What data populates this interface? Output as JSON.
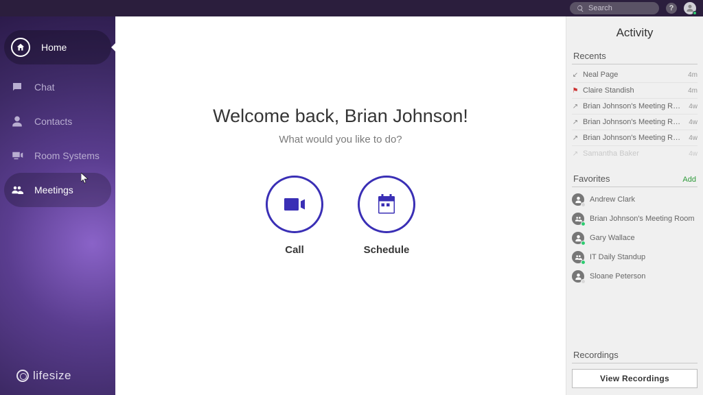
{
  "topbar": {
    "search_placeholder": "Search"
  },
  "sidebar": {
    "items": [
      {
        "label": "Home"
      },
      {
        "label": "Chat"
      },
      {
        "label": "Contacts"
      },
      {
        "label": "Room Systems"
      },
      {
        "label": "Meetings"
      }
    ],
    "logo": "lifesize"
  },
  "main": {
    "welcome": "Welcome back, Brian Johnson!",
    "subtitle": "What would you like to do?",
    "call_label": "Call",
    "schedule_label": "Schedule"
  },
  "activity": {
    "title": "Activity",
    "recents_header": "Recents",
    "recents": [
      {
        "dir": "in",
        "name": "Neal Page",
        "time": "4m"
      },
      {
        "dir": "flag",
        "name": "Claire Standish",
        "time": "4m"
      },
      {
        "dir": "out",
        "name": "Brian Johnson's Meeting Room",
        "time": "4w"
      },
      {
        "dir": "out",
        "name": "Brian Johnson's Meeting Room",
        "time": "4w"
      },
      {
        "dir": "out",
        "name": "Brian Johnson's Meeting Room",
        "time": "4w"
      },
      {
        "dir": "out",
        "name": "Samantha Baker",
        "time": "4w",
        "faded": true
      }
    ],
    "favorites_header": "Favorites",
    "favorites_add": "Add",
    "favorites": [
      {
        "name": "Andrew Clark",
        "type": "person",
        "status": "gray"
      },
      {
        "name": "Brian Johnson's Meeting Room",
        "type": "group",
        "status": "green"
      },
      {
        "name": "Gary Wallace",
        "type": "person",
        "status": "green"
      },
      {
        "name": "IT Daily Standup",
        "type": "group",
        "status": "green"
      },
      {
        "name": "Sloane Peterson",
        "type": "person",
        "status": "gray"
      }
    ],
    "recordings_header": "Recordings",
    "view_recordings": "View Recordings"
  }
}
